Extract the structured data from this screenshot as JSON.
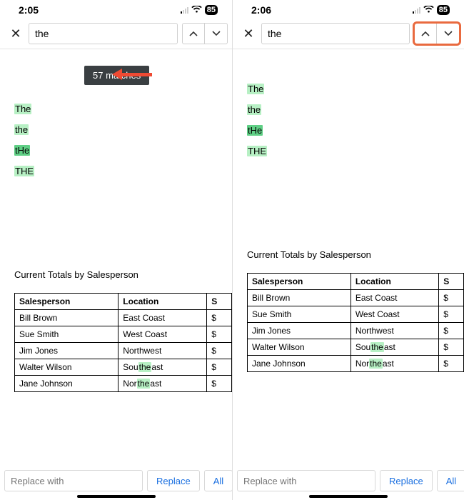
{
  "left": {
    "status": {
      "time": "2:05",
      "battery": "85"
    },
    "search": {
      "value": "the"
    },
    "match_tooltip": "57 matches",
    "words": [
      "The",
      "the",
      "tHe",
      "THE"
    ],
    "section_title": "Current Totals by Salesperson",
    "table": {
      "headers": [
        "Salesperson",
        "Location",
        "S"
      ],
      "rows": [
        [
          "Bill Brown",
          "East Coast",
          "$"
        ],
        [
          "Sue Smith",
          "West Coast",
          "$"
        ],
        [
          "Jim Jones",
          "Northwest",
          "$"
        ],
        [
          "Walter Wilson",
          "Southeast",
          "$"
        ],
        [
          "Jane Johnson",
          "Northeast",
          "$"
        ]
      ]
    },
    "replace": {
      "placeholder": "Replace with",
      "replace_label": "Replace",
      "all_label": "All"
    }
  },
  "right": {
    "status": {
      "time": "2:06",
      "battery": "85"
    },
    "search": {
      "value": "the"
    },
    "words": [
      "The",
      "the",
      "tHe",
      "THE"
    ],
    "section_title": "Current Totals by Salesperson",
    "table": {
      "headers": [
        "Salesperson",
        "Location",
        "S"
      ],
      "rows": [
        [
          "Bill Brown",
          "East Coast",
          "$"
        ],
        [
          "Sue Smith",
          "West Coast",
          "$"
        ],
        [
          "Jim Jones",
          "Northwest",
          "$"
        ],
        [
          "Walter Wilson",
          "Southeast",
          "$"
        ],
        [
          "Jane Johnson",
          "Northeast",
          "$"
        ]
      ]
    },
    "replace": {
      "placeholder": "Replace with",
      "replace_label": "Replace",
      "all_label": "All"
    }
  }
}
